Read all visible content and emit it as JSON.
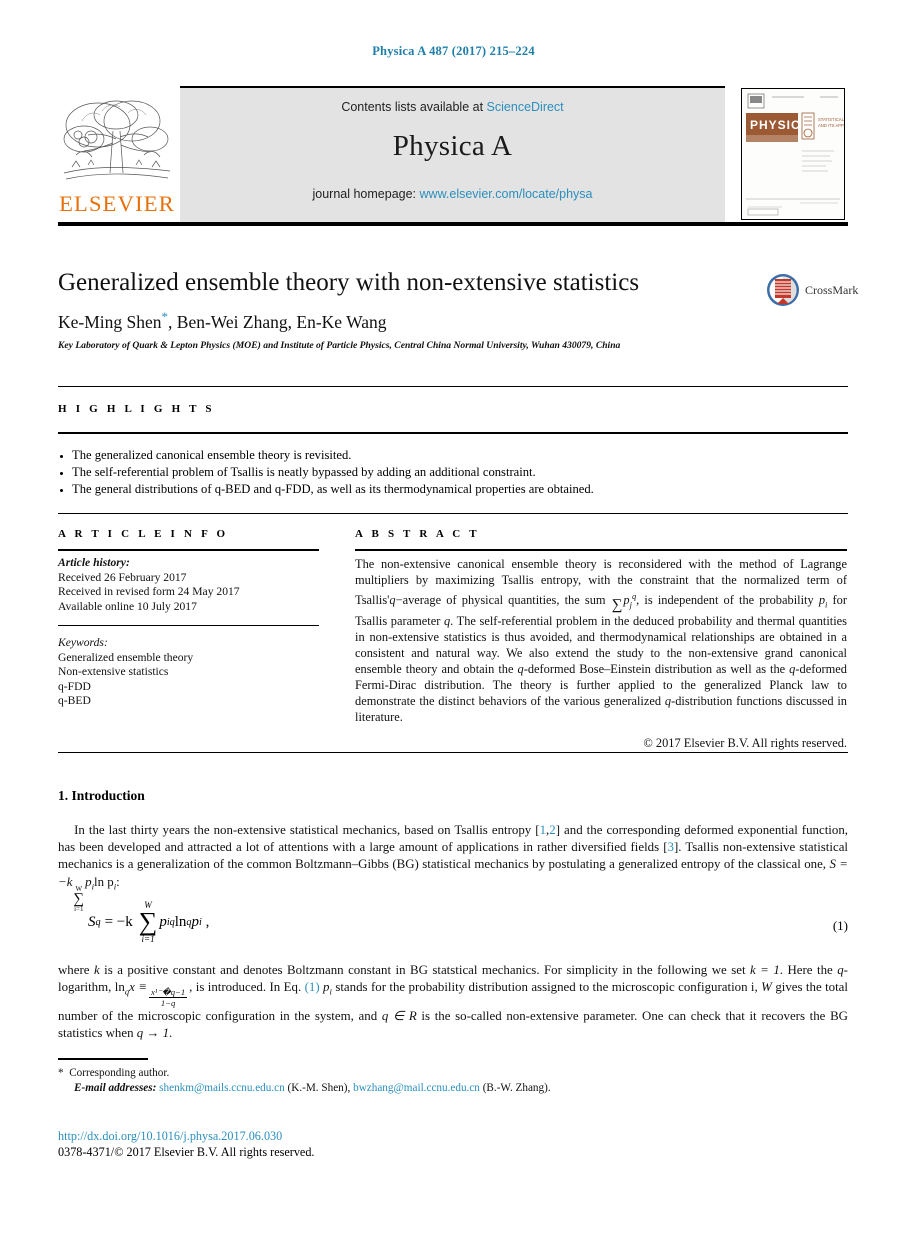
{
  "running_head": "Physica A 487 (2017) 215–224",
  "masthead": {
    "contents_prefix": "Contents lists available at",
    "contents_link": "ScienceDirect",
    "journal_title": "Physica A",
    "homepage_prefix": "journal homepage:",
    "homepage_link": "www.elsevier.com/locate/physa",
    "publisher_wordmark": "ELSEVIER",
    "cover": {
      "name": "PHYSICA",
      "subtitle": "STATISTICAL MECHANICS AND ITS APPLICATIONS"
    }
  },
  "article": {
    "title": "Generalized ensemble theory with non-extensive statistics",
    "authors": "Ke-Ming Shen",
    "authors_rest": ", Ben-Wei Zhang, En-Ke Wang",
    "corresponding_marker": "*",
    "affiliation": "Key Laboratory of Quark & Lepton Physics (MOE) and Institute of Particle Physics, Central China Normal University, Wuhan 430079, China",
    "crossmark_label": "CrossMark"
  },
  "highlights": {
    "heading": "H I G H L I G H T S",
    "items": [
      "The generalized canonical ensemble theory is revisited.",
      "The self-referential problem of Tsallis is neatly bypassed by adding an additional constraint.",
      "The general distributions of q-BED and q-FDD, as well as its thermodynamical properties are obtained."
    ]
  },
  "article_info": {
    "heading": "A R T I C L E   I N F O",
    "history_label": "Article history:",
    "received": "Received 26 February 2017",
    "revised": "Received in revised form 24 May 2017",
    "available": "Available online 10 July 2017",
    "keywords_label": "Keywords:",
    "keywords": [
      "Generalized ensemble theory",
      "Non-extensive statistics",
      "q-FDD",
      "q-BED"
    ]
  },
  "abstract": {
    "heading": "A B S T R A C T",
    "part1": "The non-extensive canonical ensemble theory is reconsidered with the method of Lagrange multipliers by maximizing Tsallis entropy, with the constraint that the normalized term of Tsallis'",
    "q_avg": "q",
    "part2": "−average of physical quantities, the sum",
    "sum_body": "p",
    "sum_sub": "j",
    "sum_sup": "q",
    "part3": ", is independent of the probability",
    "p_i": "p",
    "p_i_sub": "i",
    "part4": "for Tsallis parameter",
    "q_param": "q",
    "part5": ". The self-referential problem in the deduced probability and thermal quantities in non-extensive statistics is thus avoided, and thermodynamical relationships are obtained in a consistent and natural way. We also extend the study to the non-extensive grand canonical ensemble theory and obtain the",
    "part6": "-deformed Bose–Einstein distribution as well as the",
    "part7": "-deformed Fermi-Dirac distribution. The theory is further applied to the generalized Planck law to demonstrate the distinct behaviors of the various generalized",
    "part8": "-distribution functions discussed in literature.",
    "copyright": "© 2017 Elsevier B.V. All rights reserved."
  },
  "introduction": {
    "heading": "1. Introduction",
    "p1_a": "In the last thirty years the non-extensive statistical mechanics, based on Tsallis entropy [",
    "ref1": "1",
    "ref_comma": ",",
    "ref2": "2",
    "p1_b": "] and the corresponding deformed exponential function, has been developed and attracted a lot of attentions with a large amount of applications in rather diversified fields [",
    "ref3": "3",
    "p1_c": "]. Tsallis non-extensive statistical mechanics is a generalization of the common Boltzmann–Gibbs (BG) statistical mechanics by postulating a generalized entropy of the classical one,",
    "p1_entropy": "S = −k",
    "p1_entropy_sum_top": "W",
    "p1_entropy_sum_bot": "i=1",
    "p1_entropy_tail": "p",
    "p1_entropy_tail2": "ln p",
    "p1_end": ":",
    "equation": {
      "lhs": "S",
      "lhs_sub": "q",
      "eq": "= −k",
      "sum_top": "W",
      "sum_bot": "i=1",
      "term": "p",
      "term_sub": "i",
      "term_sup": "q",
      "ln": "ln",
      "ln_sub": "q",
      "p": "p",
      "p_sub": "i",
      "comma": ",",
      "number": "(1)"
    },
    "p2_a": "where",
    "p2_k": "k",
    "p2_b": "is a positive constant and denotes Boltzmann constant in BG statstical mechanics. For simplicity in the following we set",
    "p2_setk": "k = 1",
    "p2_c": ". Here the",
    "p2_q": "q",
    "p2_d": "-logarithm, ln",
    "p2_lnsub": "q",
    "p2_x": "x ≡",
    "frac_num": "x¹⁻�q−1",
    "frac_den": "1−q",
    "p2_e": ", is introduced. In Eq.",
    "eq_ref": "(1)",
    "p2_f": "stands for the probability distribution assigned to the microscopic configuration i,",
    "p2_W": "W",
    "p2_g": "gives the total number of the microscopic configuration in the system, and",
    "p2_qR": "q ∈ R",
    "p2_h": "is the so-called non-extensive parameter. One can check that it recovers the BG statistics when",
    "p2_qlim": "q → 1",
    "p2_i": "."
  },
  "footnote": {
    "star": "*",
    "corresponding": "Corresponding author.",
    "email_label": "E-mail addresses:",
    "email1": "shenkm@mails.ccnu.edu.cn",
    "email1_name": "(K.-M. Shen),",
    "email2": "bwzhang@mail.ccnu.edu.cn",
    "email2_name": "(B.-W. Zhang)."
  },
  "footer": {
    "doi": "http://dx.doi.org/10.1016/j.physa.2017.06.030",
    "issn_line": "0378-4371/© 2017 Elsevier B.V. All rights reserved."
  },
  "colors": {
    "link": "#2b8fbd",
    "elsevier_orange": "#e8700a",
    "band_gray": "#e3e3e3"
  }
}
